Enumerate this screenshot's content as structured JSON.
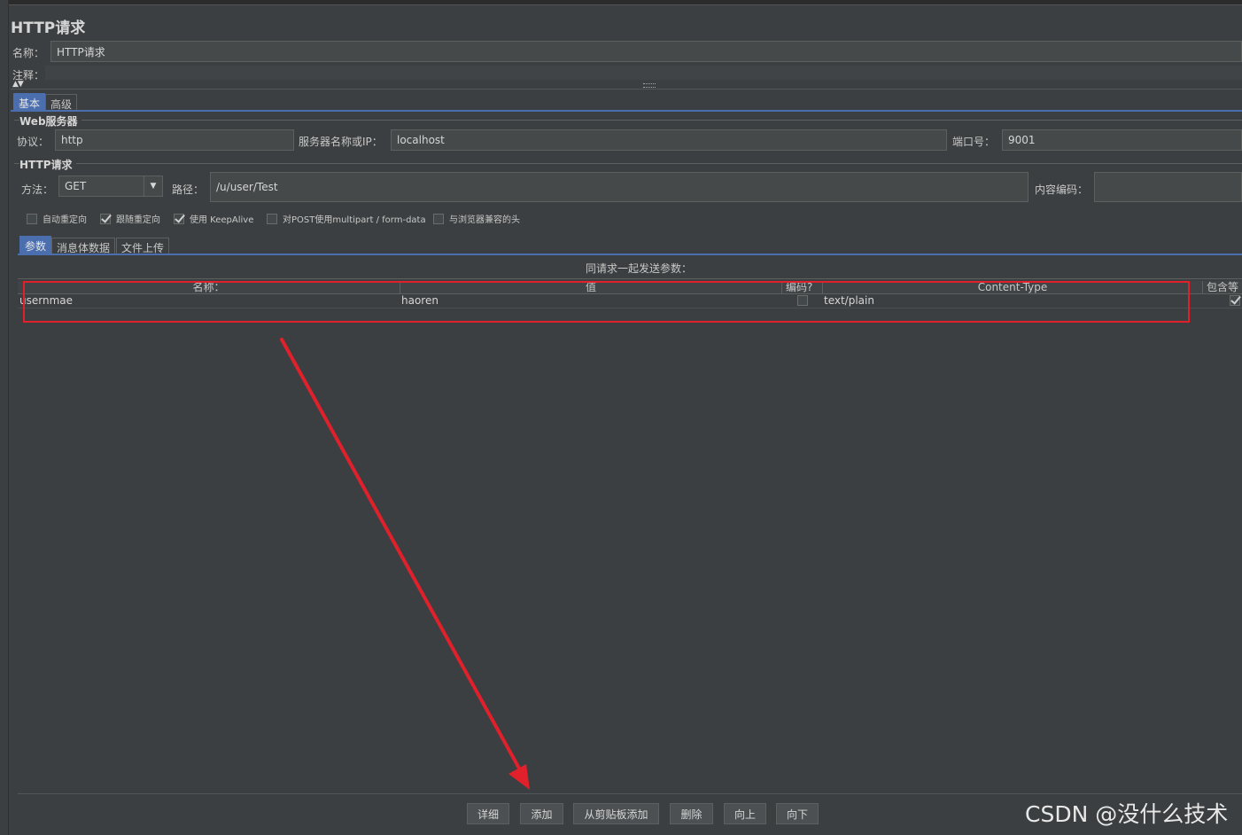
{
  "header": {
    "title": "HTTP请求"
  },
  "fields": {
    "name_label": "名称：",
    "name_value": "HTTP请求",
    "comment_label": "注释："
  },
  "top_tabs": [
    {
      "label": "基本"
    },
    {
      "label": "高级"
    }
  ],
  "web_server": {
    "title": "Web服务器",
    "protocol_label": "协议：",
    "protocol_value": "http",
    "server_label": "服务器名称或IP：",
    "server_value": "localhost",
    "port_label": "端口号：",
    "port_value": "9001"
  },
  "http_request": {
    "title": "HTTP请求",
    "method_label": "方法：",
    "method_value": "GET",
    "path_label": "路径：",
    "path_value": "/u/user/Test",
    "encoding_label": "内容编码：",
    "encoding_value": ""
  },
  "options": [
    {
      "label": "自动重定向",
      "checked": false
    },
    {
      "label": "跟随重定向",
      "checked": true
    },
    {
      "label": "使用 KeepAlive",
      "checked": true
    },
    {
      "label": "对POST使用multipart / form-data",
      "checked": false
    },
    {
      "label": "与浏览器兼容的头",
      "checked": false
    }
  ],
  "param_tabs": [
    {
      "label": "参数"
    },
    {
      "label": "消息体数据"
    },
    {
      "label": "文件上传"
    }
  ],
  "params_table": {
    "caption": "同请求一起发送参数：",
    "columns": [
      "名称：",
      "值",
      "编码?",
      "Content-Type",
      "包含等"
    ],
    "rows": [
      {
        "name": "usernmae",
        "value": "haoren",
        "encode": false,
        "content_type": "text/plain",
        "include_equals": true
      }
    ]
  },
  "buttons": {
    "detail": "详细",
    "add": "添加",
    "add_from_clipboard": "从剪贴板添加",
    "delete": "删除",
    "up": "向上",
    "down": "向下"
  },
  "watermark": "CSDN @没什么技术",
  "annotation": {
    "highlight_color": "#e0202a",
    "arrow_color": "#e0202a"
  }
}
